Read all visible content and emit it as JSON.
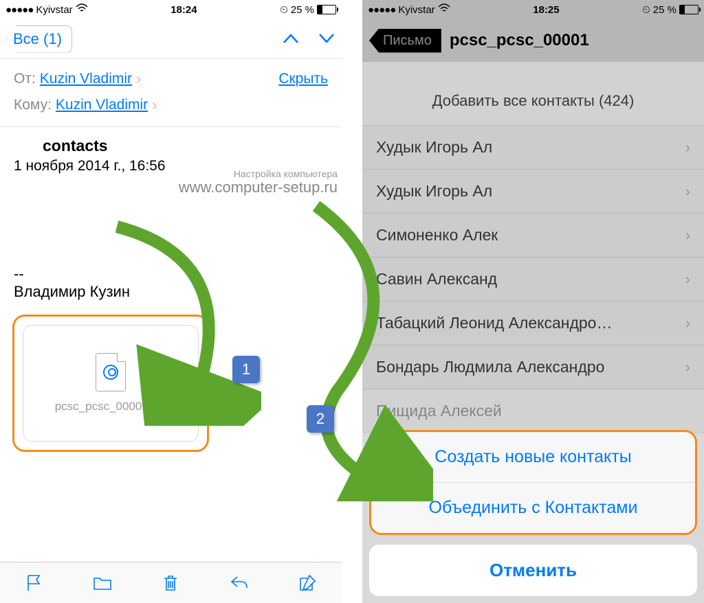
{
  "left": {
    "status": {
      "carrier": "Kyivstar",
      "time": "18:24",
      "battery": "25 %"
    },
    "nav": {
      "back": "Все (1)"
    },
    "from_label": "От:",
    "from_value": "Kuzin Vladimir",
    "to_label": "Кому:",
    "to_value": "Kuzin Vladimir",
    "hide": "Скрыть",
    "subject": "contacts",
    "date": "1 ноября 2014 г., 16:56",
    "watermark_small": "Настройка компьютера",
    "watermark_url": "www.computer-setup.ru",
    "sig1": "--",
    "sig2": "Владимир Кузин",
    "attachment": "pcsc_pcsc_00001.vcf"
  },
  "right": {
    "status": {
      "carrier": "Kyivstar",
      "time": "18:25",
      "battery": "25 %"
    },
    "back": "Письмо",
    "title": "pcsc_pcsc_00001",
    "import_all": "Добавить все контакты (424)",
    "contacts": [
      "Худык Игорь Ал",
      "Худык Игорь Ал",
      "Симоненко Алек",
      "Савин Александ",
      "Табацкий Леонид Александро…",
      "Бондарь Людмила Александро",
      "Пищида Алексей"
    ],
    "sheet": {
      "create": "Создать новые контакты",
      "merge": "Объединить с Контактами",
      "cancel": "Отменить"
    }
  },
  "badges": {
    "one": "1",
    "two": "2"
  }
}
